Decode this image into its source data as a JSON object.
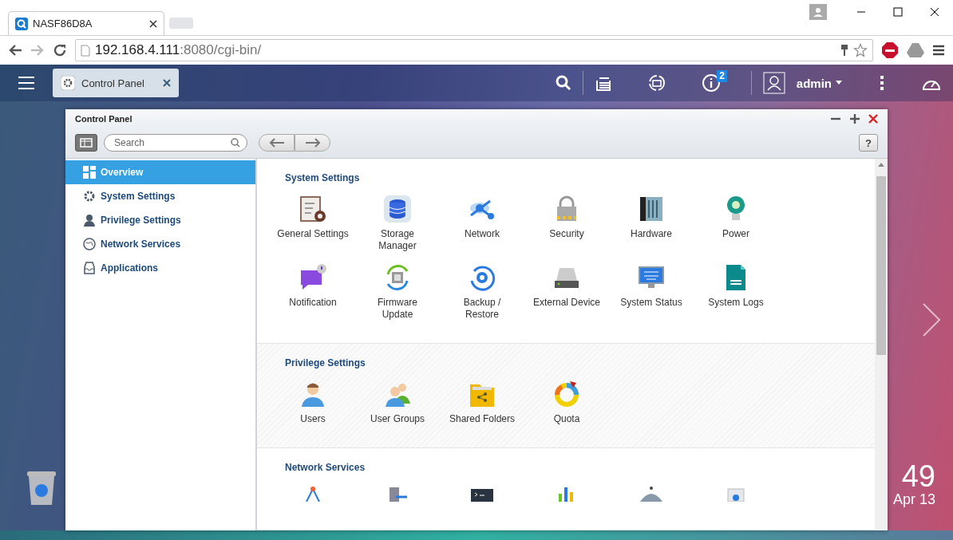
{
  "browser": {
    "tab_title": "NASF86D8A",
    "url_host": "192.168.4.111",
    "url_path": ":8080/cgi-bin/"
  },
  "appbar": {
    "open_app": "Control Panel",
    "notification_count": "2",
    "user": "admin"
  },
  "window": {
    "title": "Control Panel",
    "search": {
      "placeholder": "Search"
    },
    "help_label": "?"
  },
  "sidebar": {
    "items": [
      {
        "label": "Overview",
        "selected": true
      },
      {
        "label": "System Settings",
        "selected": false
      },
      {
        "label": "Privilege Settings",
        "selected": false
      },
      {
        "label": "Network Services",
        "selected": false
      },
      {
        "label": "Applications",
        "selected": false
      }
    ]
  },
  "sections": [
    {
      "title": "System Settings",
      "items": [
        {
          "label": "General Settings"
        },
        {
          "label": "Storage\nManager"
        },
        {
          "label": "Network"
        },
        {
          "label": "Security"
        },
        {
          "label": "Hardware"
        },
        {
          "label": "Power"
        },
        {
          "label": "Notification"
        },
        {
          "label": "Firmware\nUpdate"
        },
        {
          "label": "Backup /\nRestore"
        },
        {
          "label": "External Device"
        },
        {
          "label": "System Status"
        },
        {
          "label": "System Logs"
        }
      ]
    },
    {
      "title": "Privilege Settings",
      "items": [
        {
          "label": "Users"
        },
        {
          "label": "User Groups"
        },
        {
          "label": "Shared Folders"
        },
        {
          "label": "Quota"
        }
      ]
    },
    {
      "title": "Network Services",
      "cut_off": true
    }
  ],
  "desktop": {
    "clock": "49",
    "date": "Apr 13"
  }
}
